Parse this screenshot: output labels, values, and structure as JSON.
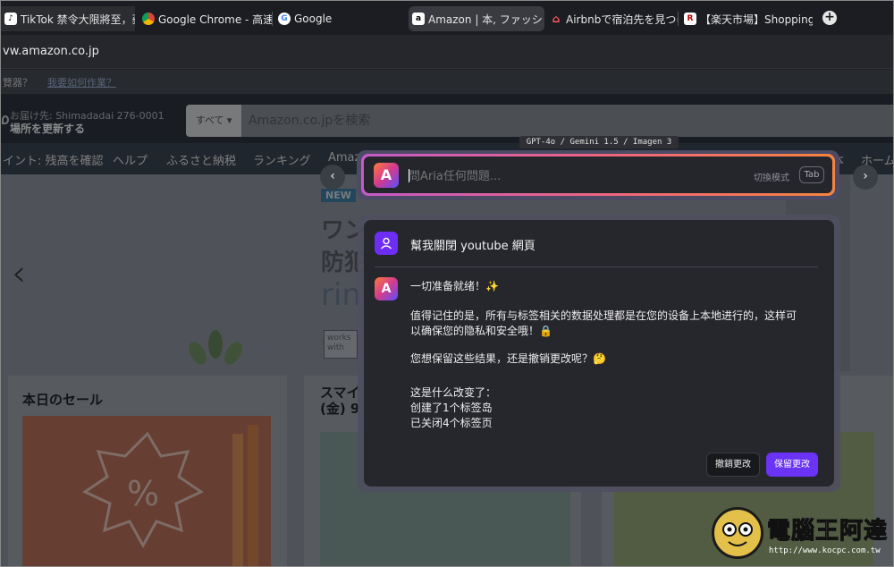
{
  "browser": {
    "tabs": [
      {
        "title": "TikTok 禁令大限將至，蘋果",
        "favicon": "tiktok"
      },
      {
        "title": "Google Chrome - 高速か",
        "favicon": "chrome"
      },
      {
        "title": "Google",
        "favicon": "google"
      },
      {
        "title": "Amazon | 本, ファッショ",
        "favicon": "amazon"
      },
      {
        "title": "Airbnbで宿泊先を見つけ",
        "favicon": "airbnb"
      },
      {
        "title": "【楽天市場】Shopping is",
        "favicon": "rakuten"
      }
    ],
    "new_tab": "+",
    "url": "vw.amazon.co.jp"
  },
  "amazon": {
    "top_note_a": "覽器？",
    "top_note_b": "我要如何作業？",
    "deliver_line1": "お届け先: Shimadadai 276-0001",
    "deliver_line2": "場所を更新する",
    "search_category": "すべて ▾",
    "search_placeholder": "Amazon.co.jpを検索",
    "nav": [
      "イント: 残高を確認",
      "ヘルプ",
      "ふるさと納税",
      "ランキング",
      "Amaz",
      "本",
      "ホーム"
    ],
    "hero_badge": "NEW",
    "hero_title1": "ワン",
    "hero_title2": "防犯",
    "hero_brand": "ring",
    "hero_works": "works with",
    "hero_prev": "‹",
    "card1_title": "本日のセール",
    "card2_title": "スマイ\n(金) 9"
  },
  "aria": {
    "models_badge": "GPT-4o / Gemini 1.5 / Imagen 3",
    "logo_glyph": "A",
    "input_placeholder": "問Aria任何問題...",
    "mode_label": "切換模式",
    "tab_key": "Tab",
    "nav_left": "‹",
    "nav_right": "›",
    "user_message": "幫我關閉 youtube 網頁",
    "bot_lines": [
      "一切准备就绪！✨",
      "值得记住的是，所有与标签相关的数据处理都是在您的设备上本地进行的，这样可",
      "以确保您的隐私和安全哦！🔒",
      "您想保留这些结果，还是撤销更改呢？🤔",
      "这是什么改变了：",
      "创建了1个标签岛",
      "已关闭4个标签页"
    ],
    "undo_button": "撤銷更改",
    "keep_button": "保留更改",
    "accent": "#6a33f5"
  },
  "watermark": {
    "text": "電腦王阿達",
    "url": "http://www.kocpc.com.tw"
  }
}
